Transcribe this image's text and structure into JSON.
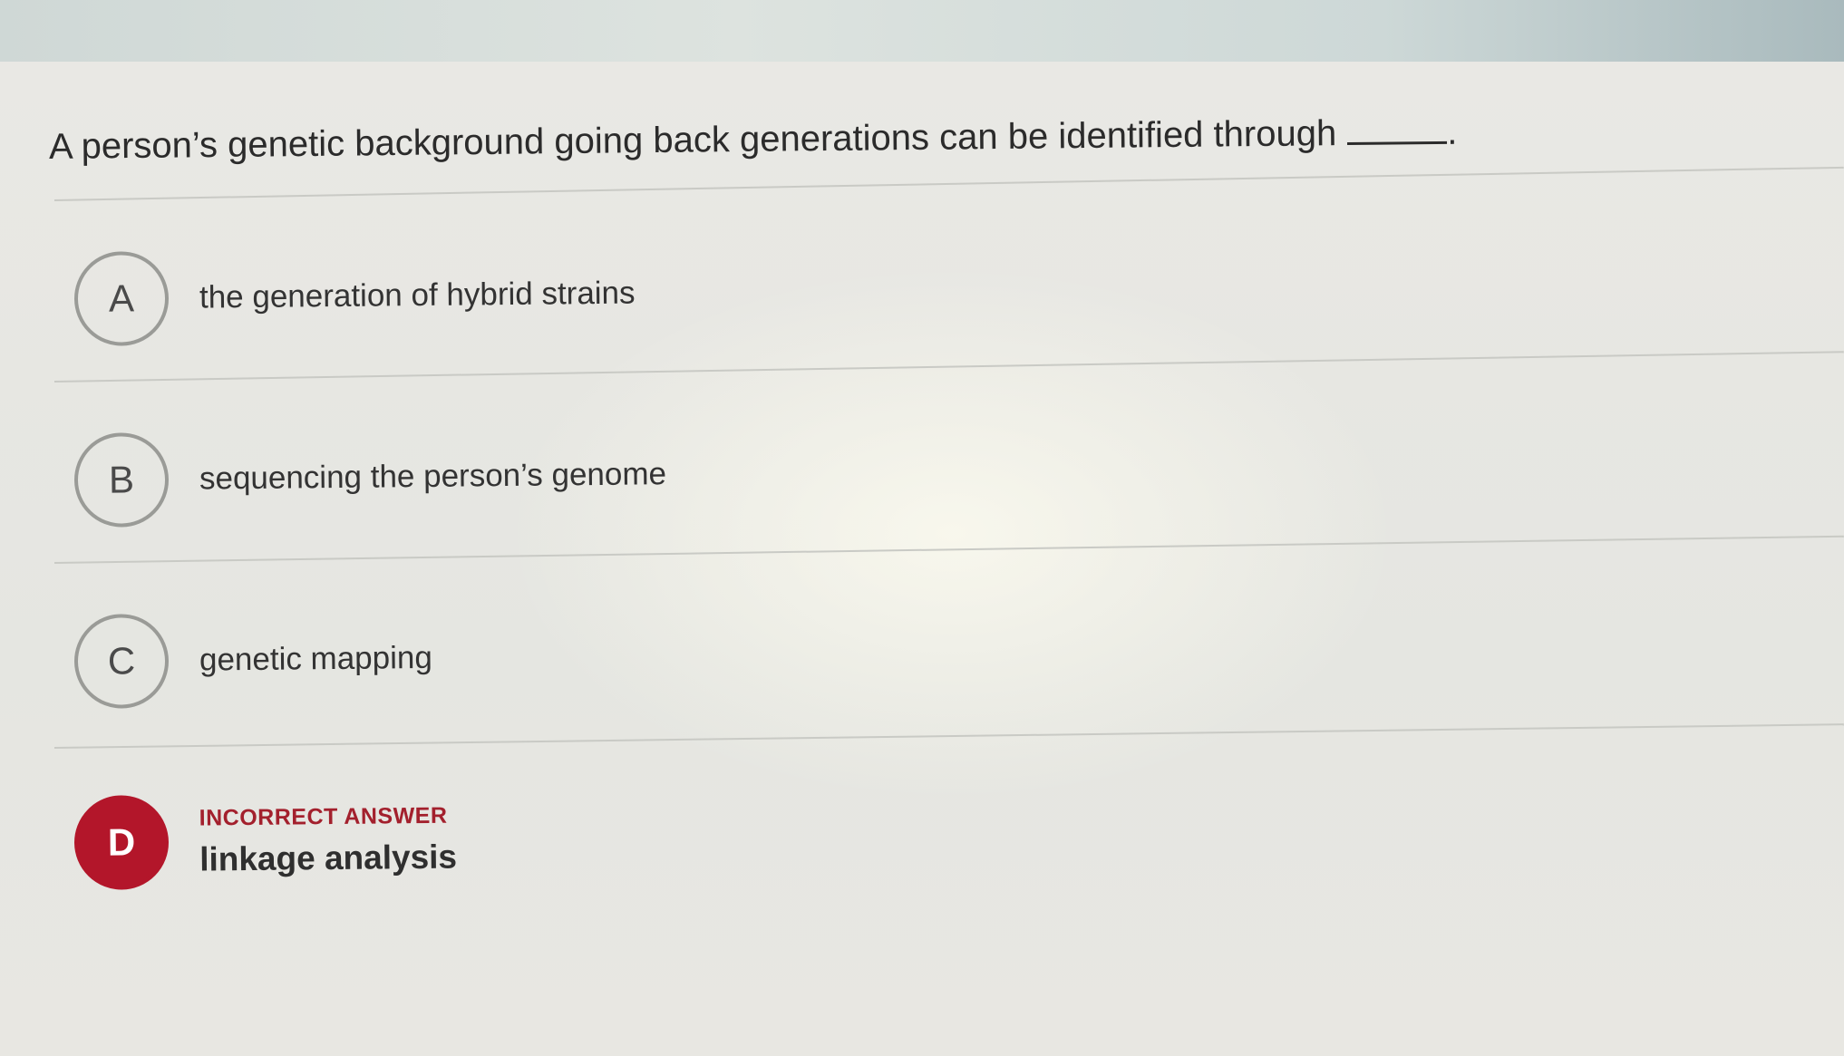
{
  "question": {
    "text": "A person’s genetic background going back generations can be identified through",
    "tail": "."
  },
  "options": [
    {
      "letter": "A",
      "text": "the generation of hybrid strains",
      "selected": false
    },
    {
      "letter": "B",
      "text": "sequencing the person’s genome",
      "selected": false
    },
    {
      "letter": "C",
      "text": "genetic mapping",
      "selected": false
    },
    {
      "letter": "D",
      "text": "linkage analysis",
      "selected": true,
      "feedback": "INCORRECT ANSWER"
    }
  ],
  "colors": {
    "incorrect": "#b3162a",
    "feedback_text": "#a3202d",
    "text": "#333333"
  }
}
